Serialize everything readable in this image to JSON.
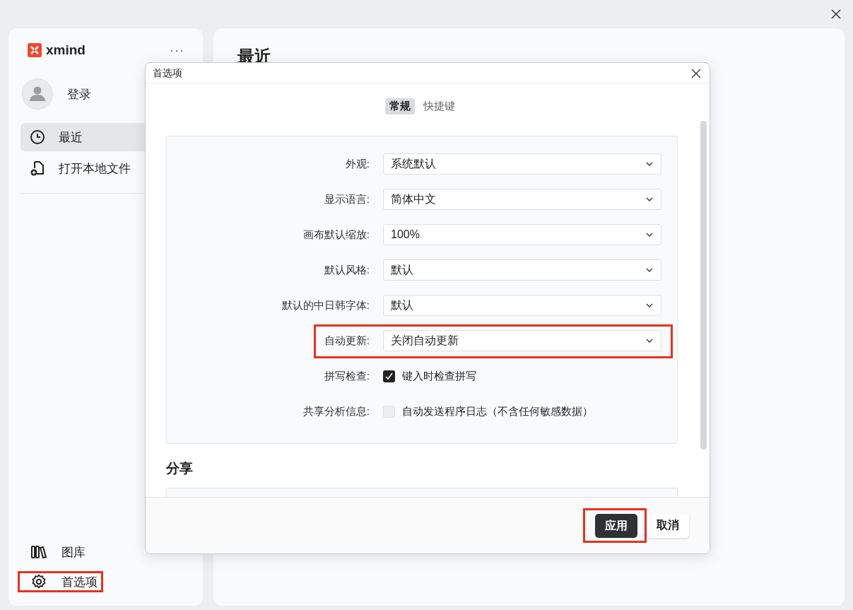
{
  "sidebar": {
    "brand": "xmind",
    "more": "···",
    "login": "登录",
    "nav": [
      {
        "label": "最近",
        "kind": "clock",
        "selected": true
      },
      {
        "label": "打开本地文件",
        "kind": "file",
        "selected": false
      }
    ],
    "bottom": [
      {
        "label": "图库",
        "kind": "library",
        "highlighted": false
      },
      {
        "label": "首选项",
        "kind": "gear",
        "highlighted": true
      }
    ]
  },
  "main": {
    "title": "最近"
  },
  "dialog": {
    "title": "首选项",
    "tabs": [
      {
        "label": "常规",
        "selected": true
      },
      {
        "label": "快捷键",
        "selected": false
      }
    ],
    "settings": [
      {
        "kind": "select",
        "label": "外观:",
        "value": "系统默认",
        "highlighted": false
      },
      {
        "kind": "select",
        "label": "显示语言:",
        "value": "简体中文",
        "highlighted": false
      },
      {
        "kind": "select",
        "label": "画布默认缩放:",
        "value": "100%",
        "highlighted": false
      },
      {
        "kind": "select",
        "label": "默认风格:",
        "value": "默认",
        "highlighted": false
      },
      {
        "kind": "select",
        "label": "默认的中日韩字体:",
        "value": "默认",
        "highlighted": false
      },
      {
        "kind": "select",
        "label": "自动更新:",
        "value": "关闭自动更新",
        "highlighted": true
      },
      {
        "kind": "checkbox",
        "label": "拼写检查:",
        "value": "键入时检查拼写",
        "checked": true
      },
      {
        "kind": "checkbox",
        "label": "共享分析信息:",
        "value": "自动发送程序日志（不含任何敏感数据）",
        "checked": false
      }
    ],
    "section": "分享",
    "buttons": [
      {
        "label": "应用",
        "kind": "primary",
        "highlighted": true
      },
      {
        "label": "取消",
        "kind": "secondary",
        "highlighted": false
      }
    ]
  }
}
